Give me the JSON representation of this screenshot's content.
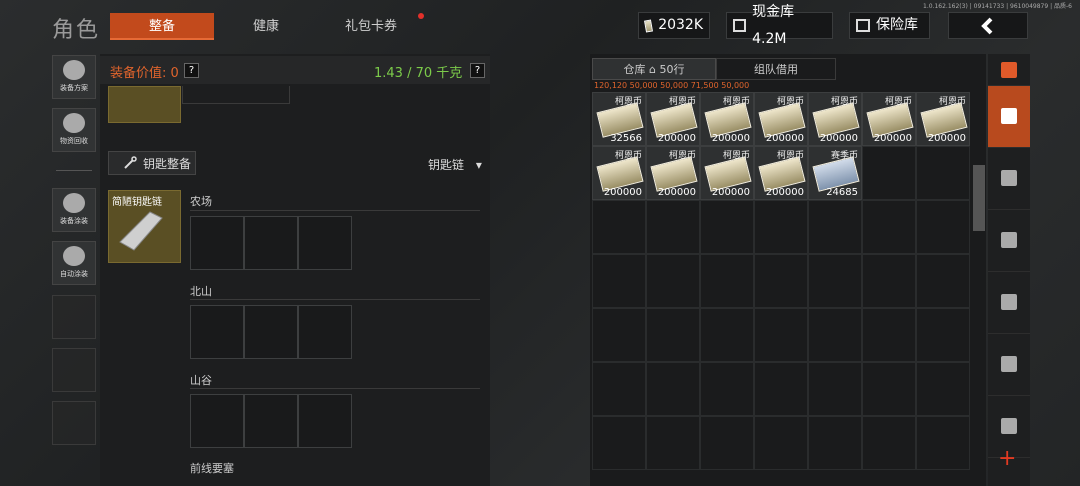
{
  "version": "1.0.162.162(3) | 09141733 | 9610049879 | 品质-6",
  "header": {
    "title": "角色",
    "tabs": [
      {
        "label": "整备",
        "active": true
      },
      {
        "label": "健康",
        "active": false
      },
      {
        "label": "礼包卡券",
        "active": false
      }
    ],
    "money": "2032K",
    "cash_vault": "现金库 4.2M",
    "safe": "保险库",
    "back_icon": "chevron-left-icon"
  },
  "side": [
    {
      "label": "装备方案",
      "icon": "helmet-icon"
    },
    {
      "label": "物资回收",
      "icon": "recycle-icon"
    },
    {
      "label": "装备涂装",
      "icon": "spray-icon"
    },
    {
      "label": "自动涂装",
      "icon": "auto-spray-icon"
    }
  ],
  "loadout": {
    "value_label": "装备价值: 0",
    "help": "?",
    "weight": "1.43 / 70 千克",
    "key_button": "钥匙整备",
    "key_select": "钥匙链",
    "key_item": "简陋钥匙链",
    "regions": [
      "农场",
      "北山",
      "山谷",
      "前线要塞"
    ]
  },
  "warehouse": {
    "tab_main": "仓库",
    "tab_rows": "50行",
    "tab_team": "组队借用",
    "partial_row": "120,120  50,000  50,000  71,500  50,000",
    "items": [
      {
        "name": "柯恩币",
        "count": "32566"
      },
      {
        "name": "柯恩币",
        "count": "200000"
      },
      {
        "name": "柯恩币",
        "count": "200000"
      },
      {
        "name": "柯恩币",
        "count": "200000"
      },
      {
        "name": "柯恩币",
        "count": "200000"
      },
      {
        "name": "柯恩币",
        "count": "200000"
      },
      {
        "name": "柯恩币",
        "count": "200000"
      },
      {
        "name": "柯恩币",
        "count": "200000"
      },
      {
        "name": "柯恩币",
        "count": "200000"
      },
      {
        "name": "柯恩币",
        "count": "200000"
      },
      {
        "name": "柯恩币",
        "count": "200000"
      },
      {
        "name": "赛季币",
        "count": "24685"
      }
    ]
  },
  "category_icons": [
    "stack-icon",
    "layers-icon",
    "vest-icon",
    "rifle-icon",
    "magazine-icon",
    "bullet-icon",
    "backpack-icon"
  ],
  "add": "+",
  "colors": {
    "accent": "#c24a1c",
    "weight": "#7ccb4a",
    "value": "#e0642c",
    "dot": "#e2302a"
  }
}
